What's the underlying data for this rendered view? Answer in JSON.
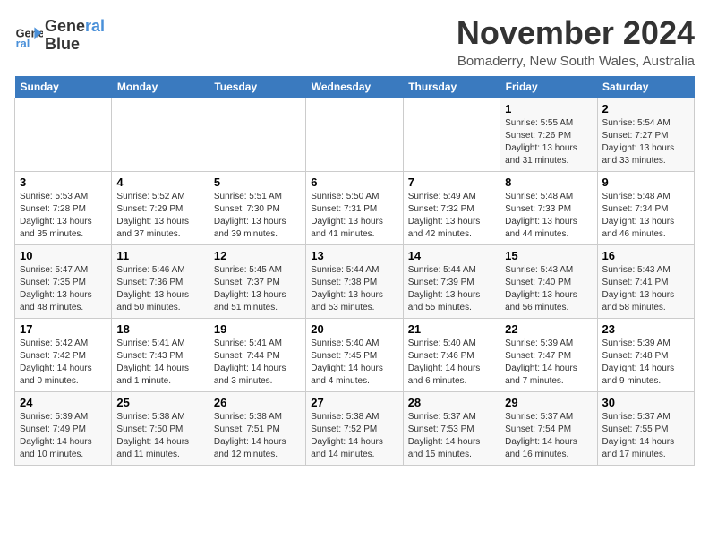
{
  "logo": {
    "line1": "General",
    "line2": "Blue"
  },
  "title": "November 2024",
  "location": "Bomaderry, New South Wales, Australia",
  "header": {
    "days": [
      "Sunday",
      "Monday",
      "Tuesday",
      "Wednesday",
      "Thursday",
      "Friday",
      "Saturday"
    ]
  },
  "weeks": [
    [
      {
        "day": "",
        "info": ""
      },
      {
        "day": "",
        "info": ""
      },
      {
        "day": "",
        "info": ""
      },
      {
        "day": "",
        "info": ""
      },
      {
        "day": "",
        "info": ""
      },
      {
        "day": "1",
        "info": "Sunrise: 5:55 AM\nSunset: 7:26 PM\nDaylight: 13 hours\nand 31 minutes."
      },
      {
        "day": "2",
        "info": "Sunrise: 5:54 AM\nSunset: 7:27 PM\nDaylight: 13 hours\nand 33 minutes."
      }
    ],
    [
      {
        "day": "3",
        "info": "Sunrise: 5:53 AM\nSunset: 7:28 PM\nDaylight: 13 hours\nand 35 minutes."
      },
      {
        "day": "4",
        "info": "Sunrise: 5:52 AM\nSunset: 7:29 PM\nDaylight: 13 hours\nand 37 minutes."
      },
      {
        "day": "5",
        "info": "Sunrise: 5:51 AM\nSunset: 7:30 PM\nDaylight: 13 hours\nand 39 minutes."
      },
      {
        "day": "6",
        "info": "Sunrise: 5:50 AM\nSunset: 7:31 PM\nDaylight: 13 hours\nand 41 minutes."
      },
      {
        "day": "7",
        "info": "Sunrise: 5:49 AM\nSunset: 7:32 PM\nDaylight: 13 hours\nand 42 minutes."
      },
      {
        "day": "8",
        "info": "Sunrise: 5:48 AM\nSunset: 7:33 PM\nDaylight: 13 hours\nand 44 minutes."
      },
      {
        "day": "9",
        "info": "Sunrise: 5:48 AM\nSunset: 7:34 PM\nDaylight: 13 hours\nand 46 minutes."
      }
    ],
    [
      {
        "day": "10",
        "info": "Sunrise: 5:47 AM\nSunset: 7:35 PM\nDaylight: 13 hours\nand 48 minutes."
      },
      {
        "day": "11",
        "info": "Sunrise: 5:46 AM\nSunset: 7:36 PM\nDaylight: 13 hours\nand 50 minutes."
      },
      {
        "day": "12",
        "info": "Sunrise: 5:45 AM\nSunset: 7:37 PM\nDaylight: 13 hours\nand 51 minutes."
      },
      {
        "day": "13",
        "info": "Sunrise: 5:44 AM\nSunset: 7:38 PM\nDaylight: 13 hours\nand 53 minutes."
      },
      {
        "day": "14",
        "info": "Sunrise: 5:44 AM\nSunset: 7:39 PM\nDaylight: 13 hours\nand 55 minutes."
      },
      {
        "day": "15",
        "info": "Sunrise: 5:43 AM\nSunset: 7:40 PM\nDaylight: 13 hours\nand 56 minutes."
      },
      {
        "day": "16",
        "info": "Sunrise: 5:43 AM\nSunset: 7:41 PM\nDaylight: 13 hours\nand 58 minutes."
      }
    ],
    [
      {
        "day": "17",
        "info": "Sunrise: 5:42 AM\nSunset: 7:42 PM\nDaylight: 14 hours\nand 0 minutes."
      },
      {
        "day": "18",
        "info": "Sunrise: 5:41 AM\nSunset: 7:43 PM\nDaylight: 14 hours\nand 1 minute."
      },
      {
        "day": "19",
        "info": "Sunrise: 5:41 AM\nSunset: 7:44 PM\nDaylight: 14 hours\nand 3 minutes."
      },
      {
        "day": "20",
        "info": "Sunrise: 5:40 AM\nSunset: 7:45 PM\nDaylight: 14 hours\nand 4 minutes."
      },
      {
        "day": "21",
        "info": "Sunrise: 5:40 AM\nSunset: 7:46 PM\nDaylight: 14 hours\nand 6 minutes."
      },
      {
        "day": "22",
        "info": "Sunrise: 5:39 AM\nSunset: 7:47 PM\nDaylight: 14 hours\nand 7 minutes."
      },
      {
        "day": "23",
        "info": "Sunrise: 5:39 AM\nSunset: 7:48 PM\nDaylight: 14 hours\nand 9 minutes."
      }
    ],
    [
      {
        "day": "24",
        "info": "Sunrise: 5:39 AM\nSunset: 7:49 PM\nDaylight: 14 hours\nand 10 minutes."
      },
      {
        "day": "25",
        "info": "Sunrise: 5:38 AM\nSunset: 7:50 PM\nDaylight: 14 hours\nand 11 minutes."
      },
      {
        "day": "26",
        "info": "Sunrise: 5:38 AM\nSunset: 7:51 PM\nDaylight: 14 hours\nand 12 minutes."
      },
      {
        "day": "27",
        "info": "Sunrise: 5:38 AM\nSunset: 7:52 PM\nDaylight: 14 hours\nand 14 minutes."
      },
      {
        "day": "28",
        "info": "Sunrise: 5:37 AM\nSunset: 7:53 PM\nDaylight: 14 hours\nand 15 minutes."
      },
      {
        "day": "29",
        "info": "Sunrise: 5:37 AM\nSunset: 7:54 PM\nDaylight: 14 hours\nand 16 minutes."
      },
      {
        "day": "30",
        "info": "Sunrise: 5:37 AM\nSunset: 7:55 PM\nDaylight: 14 hours\nand 17 minutes."
      }
    ]
  ]
}
